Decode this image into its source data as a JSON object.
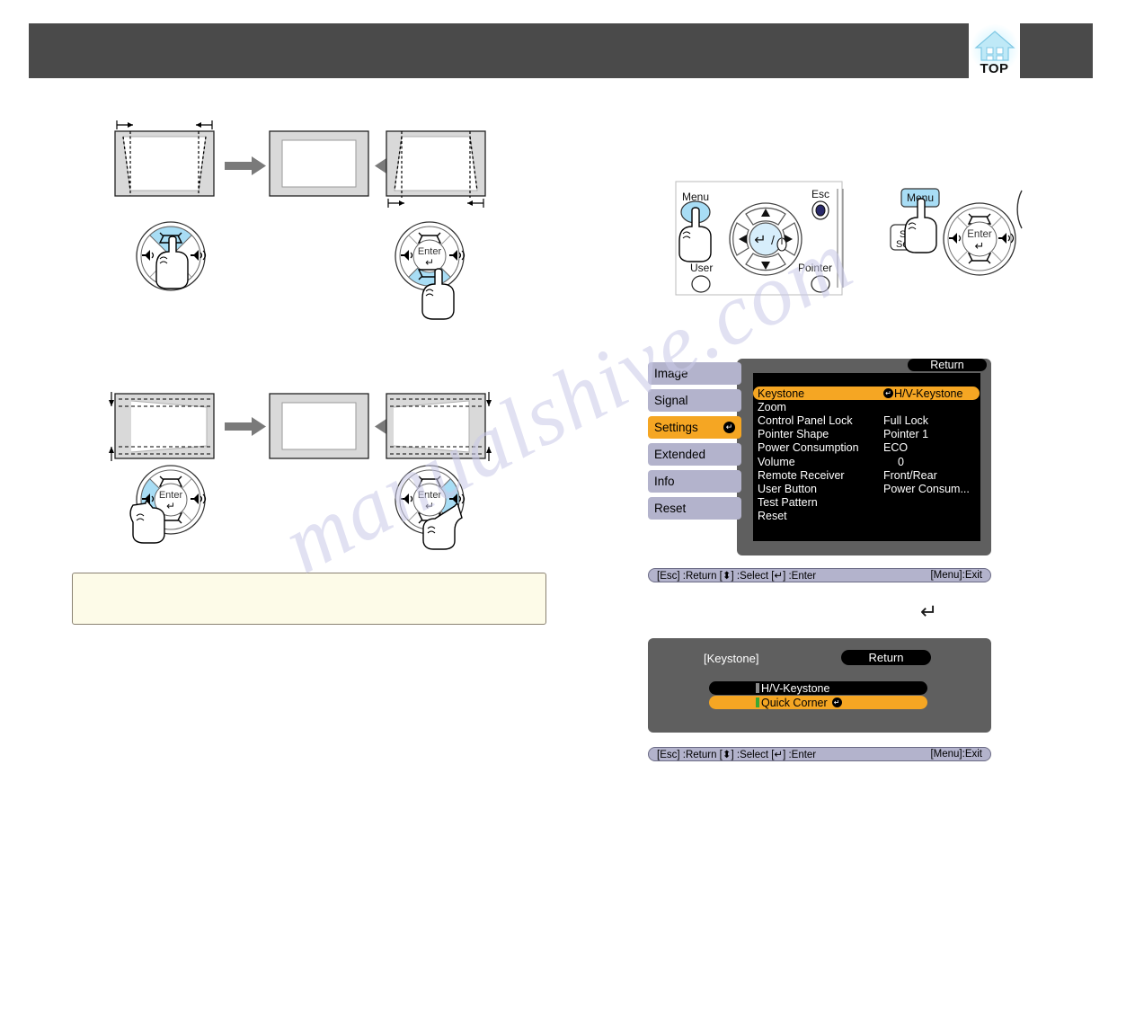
{
  "page": {
    "watermark_text": "manualshive.com",
    "header_bar_color": "#4a4a4a",
    "accent_orange": "#f5a623",
    "sidebar_lavender": "#b3b3cc",
    "osd_panel_gray": "#5f5f5f"
  },
  "top_logo": {
    "label": "TOP",
    "icon": "house-icon"
  },
  "osd_settings": {
    "return_label": "Return",
    "sidebar": [
      {
        "label": "Image",
        "selected": false,
        "enter_mark": ""
      },
      {
        "label": "Signal",
        "selected": false,
        "enter_mark": ""
      },
      {
        "label": "Settings",
        "selected": true,
        "enter_mark": "↵"
      },
      {
        "label": "Extended",
        "selected": false,
        "enter_mark": ""
      },
      {
        "label": "Info",
        "selected": false,
        "enter_mark": ""
      },
      {
        "label": "Reset",
        "selected": false,
        "enter_mark": ""
      }
    ],
    "rows": [
      {
        "label": "Keystone",
        "value": "H/V-Keystone",
        "selected": true,
        "enter_mark": "↵"
      },
      {
        "label": "Zoom",
        "value": "",
        "selected": false,
        "enter_mark": ""
      },
      {
        "label": "Control Panel Lock",
        "value": "Full Lock",
        "selected": false,
        "enter_mark": ""
      },
      {
        "label": "Pointer Shape",
        "value": "Pointer 1",
        "selected": false,
        "enter_mark": ""
      },
      {
        "label": "Power Consumption",
        "value": "ECO",
        "selected": false,
        "enter_mark": ""
      },
      {
        "label": "Volume",
        "value": "0",
        "selected": false,
        "enter_mark": ""
      },
      {
        "label": "Remote Receiver",
        "value": "Front/Rear",
        "selected": false,
        "enter_mark": ""
      },
      {
        "label": "User Button",
        "value": "Power Consum...",
        "selected": false,
        "enter_mark": ""
      },
      {
        "label": "Test Pattern",
        "value": "",
        "selected": false,
        "enter_mark": ""
      },
      {
        "label": "Reset",
        "value": "",
        "selected": false,
        "enter_mark": ""
      }
    ]
  },
  "osd_keystone": {
    "title": "[Keystone]",
    "return_label": "Return",
    "options": [
      {
        "label": "H/V-Keystone",
        "selected": false,
        "enter_mark": ""
      },
      {
        "label": "Quick Corner",
        "selected": true,
        "enter_mark": "↵"
      }
    ]
  },
  "hint_bars": {
    "left_text": "[Esc] :Return [⬍] :Select  [↵] :Enter",
    "right_text": "[Menu]:Exit"
  },
  "enter_step_glyph": "↵",
  "remote": {
    "menu_label": "Menu",
    "esc_label": "Esc",
    "user_label": "User",
    "pointer_label": "Pointer"
  },
  "control_panel": {
    "menu_label": "Menu",
    "source_search_label_line1": "Sour",
    "source_search_label_line2": "Search",
    "enter_label": "Enter"
  },
  "keypads": {
    "enter_label": "Enter"
  }
}
